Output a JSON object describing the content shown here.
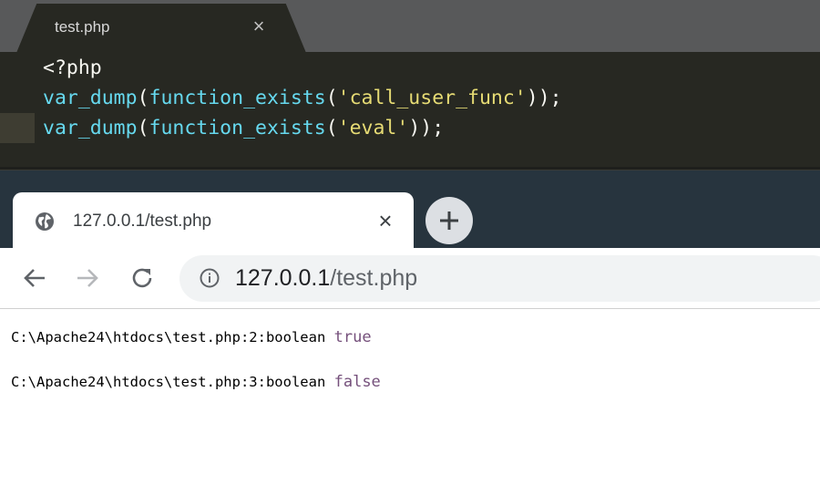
{
  "editor": {
    "tab_title": "test.php",
    "tab_close": "×",
    "code": {
      "line1": "<?php",
      "line2": {
        "fn1": "var_dump",
        "p1": "(",
        "fn2": "function_exists",
        "p2": "(",
        "str": "'call_user_func'",
        "p3": "));"
      },
      "line3": {
        "fn1": "var_dump",
        "p1": "(",
        "fn2": "function_exists",
        "p2": "(",
        "str": "'eval'",
        "p3": "));"
      }
    }
  },
  "browser": {
    "tab_title": "127.0.0.1/test.php",
    "tab_close": "×",
    "omnibox": {
      "host": "127.0.0.1",
      "path": "/test.php"
    }
  },
  "page": {
    "lines": [
      {
        "prefix": "C:\\Apache24\\htdocs\\test.php:2:boolean ",
        "value": "true"
      },
      {
        "prefix": "C:\\Apache24\\htdocs\\test.php:3:boolean ",
        "value": "false"
      }
    ]
  },
  "colors": {
    "editor_bg": "#272822",
    "keyword": "#66d9ef",
    "string": "#e6db74",
    "boolean": "#75507b",
    "browser_frame": "#27343e"
  },
  "icons": [
    "globe-icon",
    "close-icon",
    "plus-icon",
    "back-arrow-icon",
    "forward-arrow-icon",
    "reload-icon",
    "info-icon"
  ]
}
